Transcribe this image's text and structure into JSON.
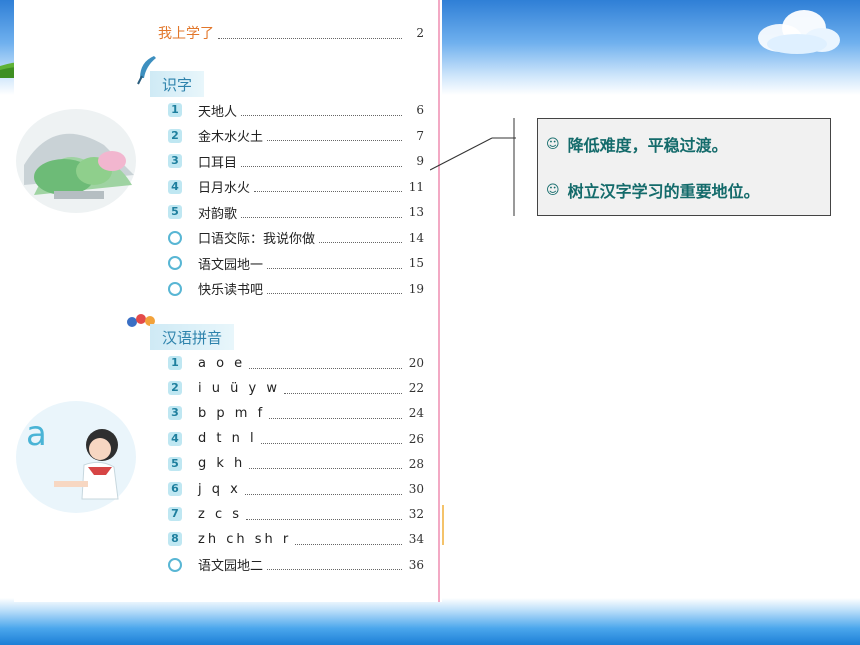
{
  "colors": {
    "accent_orange": "#e2772b",
    "section_blue": "#2e83ac",
    "note_text": "#146b6b",
    "badge_bg": "#bfe7f2"
  },
  "toc": {
    "first_entry": {
      "title": "我上学了",
      "page": "2"
    },
    "sections": [
      {
        "title": "识字",
        "entries": [
          {
            "marker": "1",
            "title": "天地人",
            "page": "6"
          },
          {
            "marker": "2",
            "title": "金木水火土",
            "page": "7"
          },
          {
            "marker": "3",
            "title": "口耳目",
            "page": "9"
          },
          {
            "marker": "4",
            "title": "日月水火",
            "page": "11"
          },
          {
            "marker": "5",
            "title": "对韵歌",
            "page": "13"
          },
          {
            "marker": "◎",
            "title": "口语交际：我说你做",
            "page": "14"
          },
          {
            "marker": "◎",
            "title": "语文园地一",
            "page": "15"
          },
          {
            "marker": "◎",
            "title": "快乐读书吧",
            "page": "19"
          }
        ]
      },
      {
        "title": "汉语拼音",
        "entries": [
          {
            "marker": "1",
            "title": "a o e",
            "page": "20"
          },
          {
            "marker": "2",
            "title": "i u ü y w",
            "page": "22"
          },
          {
            "marker": "3",
            "title": "b p m f",
            "page": "24"
          },
          {
            "marker": "4",
            "title": "d t n l",
            "page": "26"
          },
          {
            "marker": "5",
            "title": "g k h",
            "page": "28"
          },
          {
            "marker": "6",
            "title": "j q x",
            "page": "30"
          },
          {
            "marker": "7",
            "title": "z c s",
            "page": "32"
          },
          {
            "marker": "8",
            "title": "zh ch sh r",
            "page": "34"
          },
          {
            "marker": "◎",
            "title": "语文园地二",
            "page": "36"
          }
        ]
      }
    ]
  },
  "illustrations": {
    "pinyin_letter": "a"
  },
  "note": {
    "icon": "smiley-icon",
    "lines": [
      "降低难度，平稳过渡。",
      "树立汉字学习的重要地位。"
    ]
  }
}
